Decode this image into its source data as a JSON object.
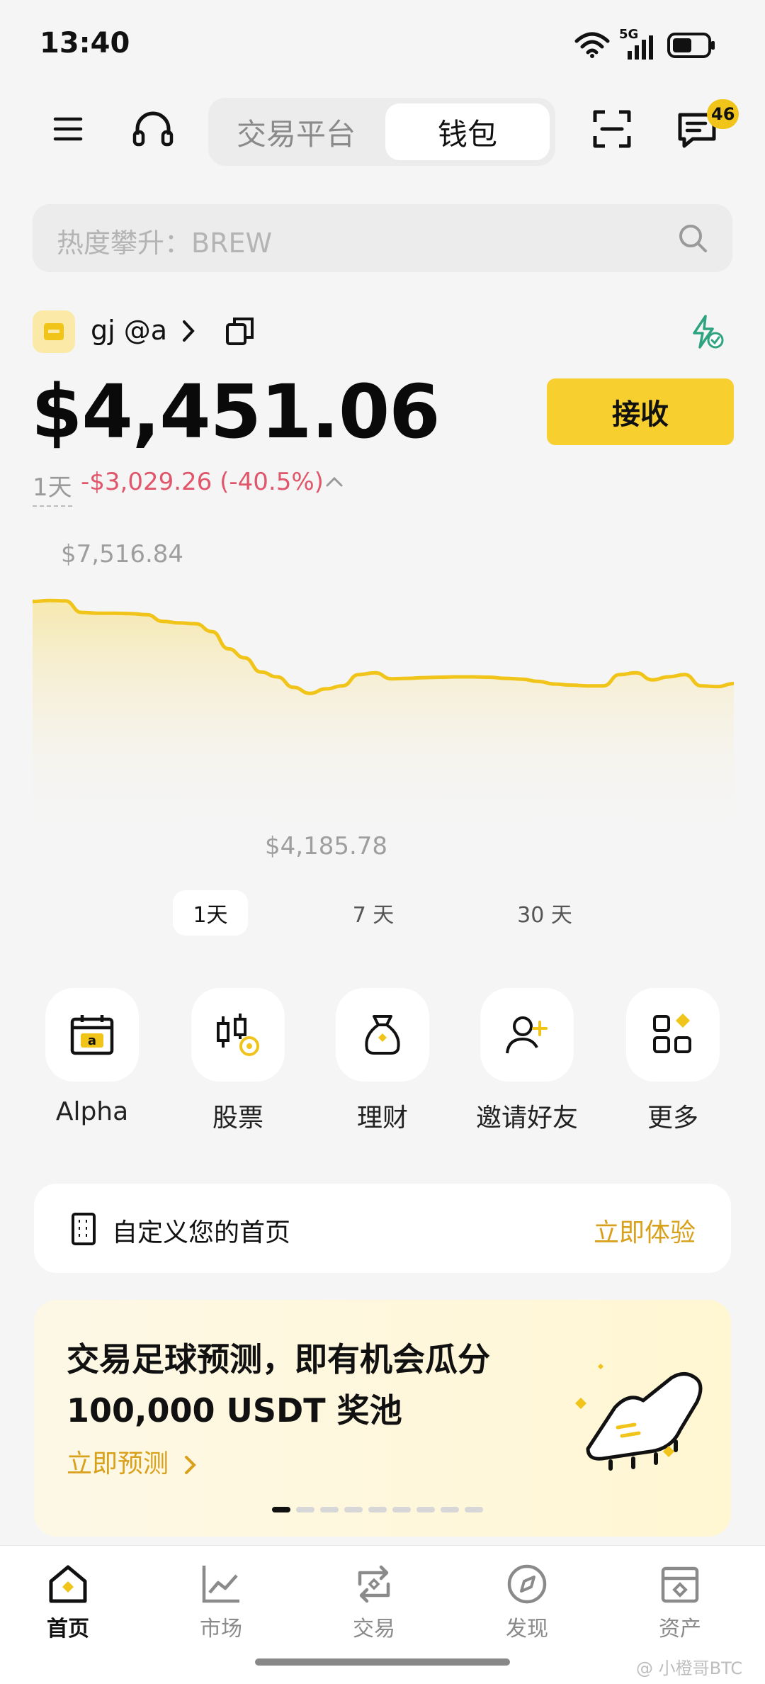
{
  "status_bar": {
    "time": "13:40",
    "network": "5G"
  },
  "top_nav": {
    "tabs": [
      {
        "label": "交易平台",
        "active": false
      },
      {
        "label": "钱包",
        "active": true
      }
    ],
    "message_badge": "46"
  },
  "search": {
    "placeholder": "热度攀升：BREW"
  },
  "account": {
    "name": "gj @a"
  },
  "balance": {
    "amount": "$4,451.06",
    "period": "1天",
    "change": "-$3,029.26 (-40.5%)",
    "receive_label": "接收"
  },
  "chart_data": {
    "type": "area",
    "max_label": "$7,516.84",
    "min_label": "$4,185.78",
    "ylim": [
      4185.78,
      7516.84
    ],
    "y": [
      7350,
      7380,
      7370,
      7060,
      7040,
      7040,
      7030,
      7000,
      6820,
      6780,
      6760,
      6550,
      6090,
      5850,
      5470,
      5340,
      5060,
      4900,
      5020,
      5100,
      5400,
      5450,
      5290,
      5300,
      5320,
      5330,
      5340,
      5340,
      5330,
      5300,
      5280,
      5220,
      5150,
      5120,
      5100,
      5100,
      5400,
      5450,
      5260,
      5340,
      5400,
      5100,
      5080,
      5160
    ],
    "series_color": "#f0c419"
  },
  "period_tabs": [
    {
      "label": "1天",
      "active": true
    },
    {
      "label": "7 天",
      "active": false
    },
    {
      "label": "30 天",
      "active": false
    }
  ],
  "quick_actions": [
    {
      "label": "Alpha",
      "icon": "calendar-alpha-icon"
    },
    {
      "label": "股票",
      "icon": "stock-icon"
    },
    {
      "label": "理财",
      "icon": "money-bag-icon"
    },
    {
      "label": "邀请好友",
      "icon": "add-user-icon"
    },
    {
      "label": "更多",
      "icon": "more-grid-icon"
    }
  ],
  "customize": {
    "text": "自定义您的首页",
    "cta": "立即体验"
  },
  "promo": {
    "title_line1": "交易足球预测，即有机会瓜分",
    "title_line2": "100,000 USDT 奖池",
    "cta": "立即预测",
    "slides": 9,
    "active_slide": 0
  },
  "bottom_nav": [
    {
      "label": "首页",
      "icon": "home-icon",
      "active": true
    },
    {
      "label": "市场",
      "icon": "market-chart-icon",
      "active": false
    },
    {
      "label": "交易",
      "icon": "trade-icon",
      "active": false
    },
    {
      "label": "发现",
      "icon": "discover-icon",
      "active": false
    },
    {
      "label": "资产",
      "icon": "wallet-icon",
      "active": false
    }
  ],
  "watermark": "@ 小橙哥BTC",
  "colors": {
    "accent": "#f7cf2f",
    "negative": "#e0566a",
    "link": "#d9a01b"
  }
}
